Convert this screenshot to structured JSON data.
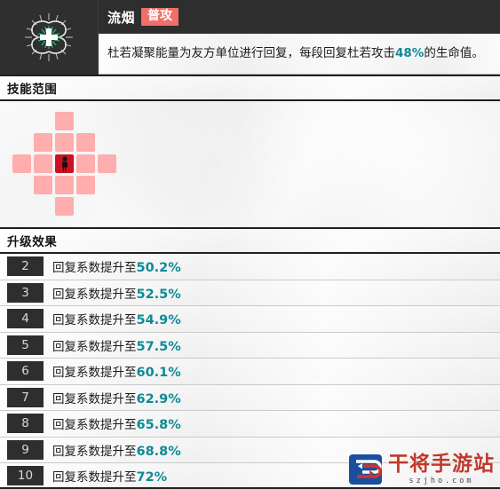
{
  "skill": {
    "icon_name": "healing-cross-icon",
    "name": "流烟",
    "tag": "普攻",
    "description_before": "杜若凝聚能量为友方单位进行回复，每段回复杜若攻击",
    "description_highlight": "48%",
    "description_after": "的生命值。"
  },
  "sections": {
    "range_title": "技能范围",
    "upgrade_title": "升级效果"
  },
  "range_grid": {
    "rows": 5,
    "cols": 5,
    "legend_self": "self-unit-cell",
    "legend_range": "range-cell",
    "pattern": [
      [
        "empty",
        "empty",
        "range",
        "empty",
        "empty"
      ],
      [
        "empty",
        "range",
        "range",
        "range",
        "empty"
      ],
      [
        "range",
        "range",
        "self",
        "range",
        "range"
      ],
      [
        "empty",
        "range",
        "range",
        "range",
        "empty"
      ],
      [
        "empty",
        "empty",
        "range",
        "empty",
        "empty"
      ]
    ]
  },
  "upgrades": [
    {
      "level": "2",
      "text": "回复系数提升至",
      "value": "50.2%"
    },
    {
      "level": "3",
      "text": "回复系数提升至",
      "value": "52.5%"
    },
    {
      "level": "4",
      "text": "回复系数提升至",
      "value": "54.9%"
    },
    {
      "level": "5",
      "text": "回复系数提升至",
      "value": "57.5%"
    },
    {
      "level": "6",
      "text": "回复系数提升至",
      "value": "60.1%"
    },
    {
      "level": "7",
      "text": "回复系数提升至",
      "value": "62.9%"
    },
    {
      "level": "8",
      "text": "回复系数提升至",
      "value": "65.8%"
    },
    {
      "level": "9",
      "text": "回复系数提升至",
      "value": "68.8%"
    },
    {
      "level": "10",
      "text": "回复系数提升至",
      "value": "72%"
    }
  ],
  "watermark": {
    "site_name": "干将手游站",
    "site_url": "szjho.com",
    "logo_name": "gan-jiang-logo-icon"
  },
  "colors": {
    "accent_teal": "#0f8a96",
    "tag_red": "#ef6f6b",
    "range_pink": "#ffadad",
    "self_red": "#cc1122",
    "dark_panel": "#2e2e2e",
    "watermark_red": "#c0392b",
    "watermark_blue": "#1a4fa0"
  }
}
